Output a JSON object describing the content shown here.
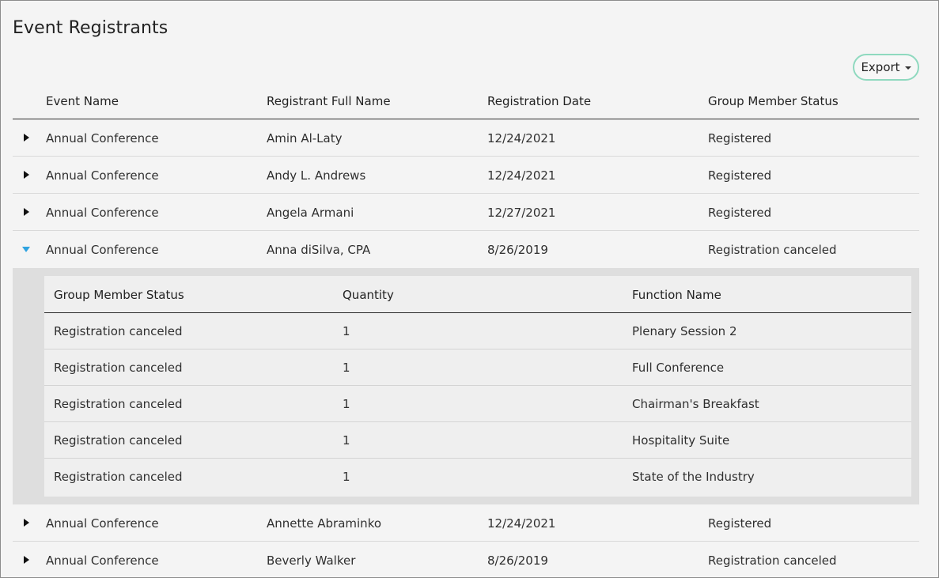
{
  "page": {
    "title": "Event Registrants",
    "export_label": "Export"
  },
  "columns": {
    "event_name": "Event Name",
    "registrant_full_name": "Registrant Full Name",
    "registration_date": "Registration Date",
    "group_member_status": "Group Member Status"
  },
  "rows": [
    {
      "event": "Annual Conference",
      "name": "Amin Al-Laty",
      "date": "12/24/2021",
      "status": "Registered",
      "expanded": false
    },
    {
      "event": "Annual Conference",
      "name": "Andy L. Andrews",
      "date": "12/24/2021",
      "status": "Registered",
      "expanded": false
    },
    {
      "event": "Annual Conference",
      "name": "Angela Armani",
      "date": "12/27/2021",
      "status": "Registered",
      "expanded": false
    },
    {
      "event": "Annual Conference",
      "name": "Anna diSilva, CPA",
      "date": "8/26/2019",
      "status": "Registration canceled",
      "expanded": true
    },
    {
      "event": "Annual Conference",
      "name": "Annette Abraminko",
      "date": "12/24/2021",
      "status": "Registered",
      "expanded": false
    },
    {
      "event": "Annual Conference",
      "name": "Beverly Walker",
      "date": "8/26/2019",
      "status": "Registration canceled",
      "expanded": false
    }
  ],
  "detail": {
    "columns": {
      "group_member_status": "Group Member Status",
      "quantity": "Quantity",
      "function_name": "Function Name"
    },
    "rows": [
      {
        "status": "Registration canceled",
        "quantity": "1",
        "function": "Plenary Session 2"
      },
      {
        "status": "Registration canceled",
        "quantity": "1",
        "function": "Full Conference"
      },
      {
        "status": "Registration canceled",
        "quantity": "1",
        "function": "Chairman's Breakfast"
      },
      {
        "status": "Registration canceled",
        "quantity": "1",
        "function": "Hospitality Suite"
      },
      {
        "status": "Registration canceled",
        "quantity": "1",
        "function": "State of the Industry"
      }
    ]
  },
  "colors": {
    "export_border": "#8fd9bf",
    "expanded_toggle": "#2ea3e0",
    "detail_background": "#dedede"
  },
  "icons": {
    "collapsed": "caret-right-icon",
    "expanded": "caret-down-icon",
    "export_dropdown": "chevron-down-icon"
  }
}
